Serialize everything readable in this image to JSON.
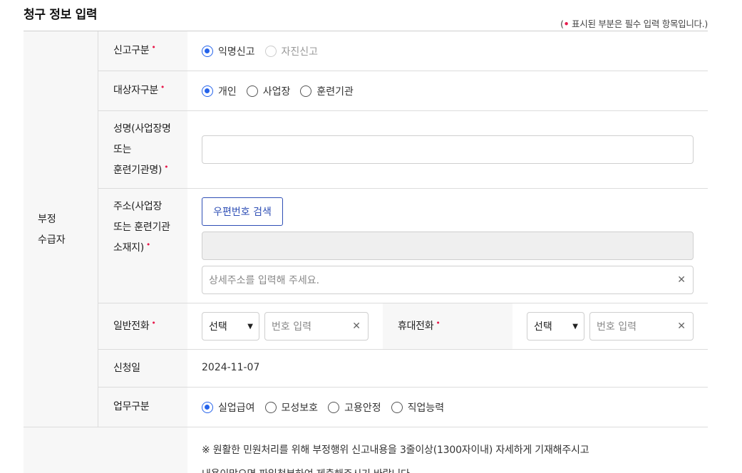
{
  "header": {
    "title": "청구 정보 입력",
    "required_note_prefix": "(",
    "required_note_dot": "•",
    "required_note_text": "표시된 부분은 필수 입력 항목입니다.)"
  },
  "section_label_line1": "부정",
  "section_label_line2": "수급자",
  "required_mark": "•",
  "report_type": {
    "label": "신고구분",
    "options": [
      "익명신고",
      "자진신고"
    ],
    "selected": "익명신고"
  },
  "target_type": {
    "label": "대상자구분",
    "options": [
      "개인",
      "사업장",
      "훈련기관"
    ],
    "selected": "개인"
  },
  "name_field": {
    "label_line1": "성명(사업장명",
    "label_line2": "또는",
    "label_line3": "훈련기관명)",
    "value": ""
  },
  "address": {
    "label_line1": "주소(사업장",
    "label_line2": "또는 훈련기관",
    "label_line3": "소재지)",
    "postcode_button": "우편번호 검색",
    "base_value": "",
    "detail_placeholder": "상세주소를 입력해 주세요."
  },
  "phone": {
    "label": "일반전화",
    "select_value": "선택",
    "number_placeholder": "번호 입력"
  },
  "mobile": {
    "label": "휴대전화",
    "select_value": "선택",
    "number_placeholder": "번호 입력"
  },
  "apply_date": {
    "label": "신청일",
    "value": "2024-11-07"
  },
  "business_type": {
    "label": "업무구분",
    "options": [
      "실업급여",
      "모성보호",
      "고용안정",
      "직업능력"
    ],
    "selected": "실업급여"
  },
  "notice": {
    "line1": "※ 원활한 민원처리를 위해 부정행위 신고내용을 3줄이상(1300자이내) 자세하게 기재해주시고",
    "line2": "내용이많으면 파일첨부하여 제출해주시기 바랍니다."
  },
  "icons": {
    "clear": "close-icon",
    "dropdown": "chevron-down-icon"
  },
  "colors": {
    "accent": "#2563eb",
    "required": "#e8194b",
    "button_border": "#2f4fb5",
    "label_bg": "#f7f7f7"
  }
}
